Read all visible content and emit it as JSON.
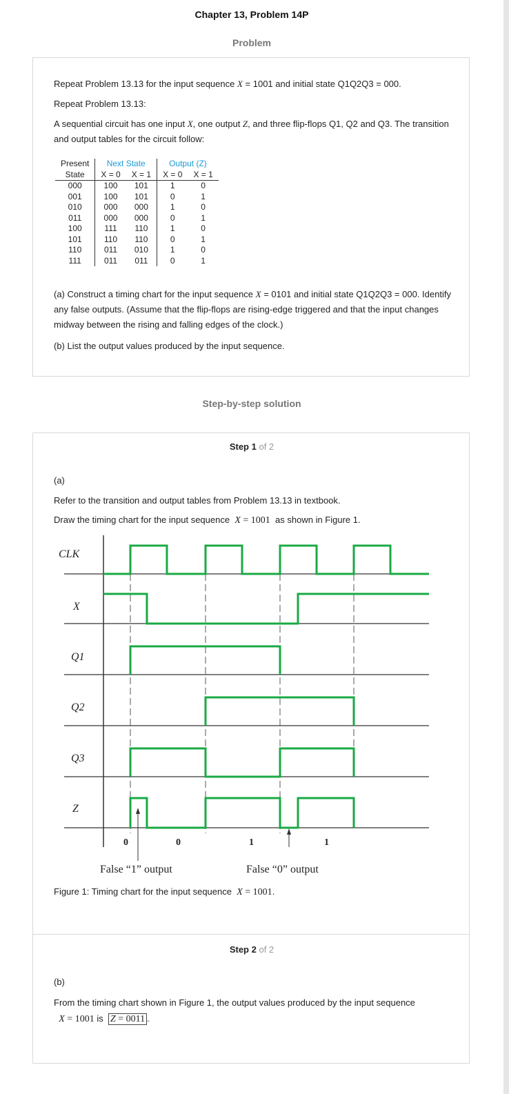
{
  "title": "Chapter 13, Problem 14P",
  "problem_heading": "Problem",
  "problem": {
    "intro_prefix": "Repeat Problem 13.13 for the input sequence ",
    "intro_var": "X",
    "intro_suffix": " = 1001 and initial state Q1Q2Q3 = 000.",
    "repeat": "Repeat Problem 13.13:",
    "desc_1": "A sequential circuit has one input ",
    "desc_x": "X",
    "desc_2": ", one output ",
    "desc_z": "Z",
    "desc_3": ", and three flip-flops Q1, Q2 and Q3. The transition and output tables for the circuit follow:",
    "table": {
      "h_present": "Present",
      "h_state": "State",
      "h_next": "Next State",
      "h_output": "Output (Z)",
      "h_x0": "X = 0",
      "h_x1": "X = 1",
      "h_ox0": "X = 0",
      "h_ox1": "X = 1",
      "rows": [
        [
          "000",
          "100",
          "101",
          "1",
          "0"
        ],
        [
          "001",
          "100",
          "101",
          "0",
          "1"
        ],
        [
          "010",
          "000",
          "000",
          "1",
          "0"
        ],
        [
          "011",
          "000",
          "000",
          "0",
          "1"
        ],
        [
          "100",
          "111",
          "110",
          "1",
          "0"
        ],
        [
          "101",
          "110",
          "110",
          "0",
          "1"
        ],
        [
          "110",
          "011",
          "010",
          "1",
          "0"
        ],
        [
          "111",
          "011",
          "011",
          "0",
          "1"
        ]
      ]
    },
    "part_a_1": "(a) Construct a timing chart for the input sequence ",
    "part_a_x": "X",
    "part_a_2": " = 0101 and initial state Q1Q2Q3 = 000. Identify any false outputs. (Assume that the flip-flops are rising-edge triggered and that the input changes midway between the rising and falling edges of the clock.)",
    "part_b": "(b) List the output values produced by the input sequence."
  },
  "solution_heading": "Step-by-step solution",
  "step1": {
    "label": "Step 1",
    "of": "of 2",
    "part": "(a)",
    "line1": "Refer to the transition and output tables from Problem 13.13 in textbook.",
    "line2_prefix": "Draw the timing chart for the input sequence",
    "line2_math_var": "X",
    "line2_math_val": " = 1001",
    "line2_suffix": "as shown in Figure 1.",
    "signals": [
      "CLK",
      "X",
      "Q1",
      "Q2",
      "Q3",
      "Z"
    ],
    "z_values": [
      "0",
      "0",
      "1",
      "1"
    ],
    "false1": "False “1” output",
    "false0": "False “0” output",
    "caption_prefix": "Figure 1: Timing chart for the input sequence",
    "caption_var": "X",
    "caption_val": " = 1001",
    "caption_end": ".",
    "colors": {
      "waveform": "#1aaa44",
      "axis": "#333333"
    }
  },
  "step2": {
    "label": "Step 2",
    "of": "of 2",
    "part": "(b)",
    "line1": "From the timing chart shown in Figure 1, the output values produced by the input sequence",
    "math_var": "X",
    "math_val": " = 1001",
    "is_word": " is ",
    "ans_var": "Z",
    "ans_val": " = 0011",
    "end": "."
  }
}
